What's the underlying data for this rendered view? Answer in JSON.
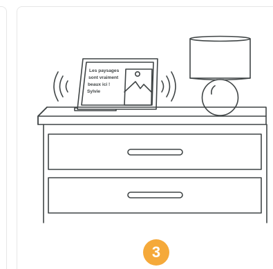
{
  "tablet_message": {
    "line1": "Les paysages",
    "line2": "sont vraiment",
    "line3": "beaux ici !",
    "line4": "Sylvie"
  },
  "step": {
    "number": "3"
  },
  "colors": {
    "stroke": "#3f4445",
    "accent": "#f5a93a",
    "card_border": "#e6e6e6",
    "background": "#ffffff"
  },
  "icons": {
    "signal_left": "wireless-waves-icon",
    "signal_right": "wireless-waves-icon",
    "picture": "landscape-picture-icon"
  }
}
